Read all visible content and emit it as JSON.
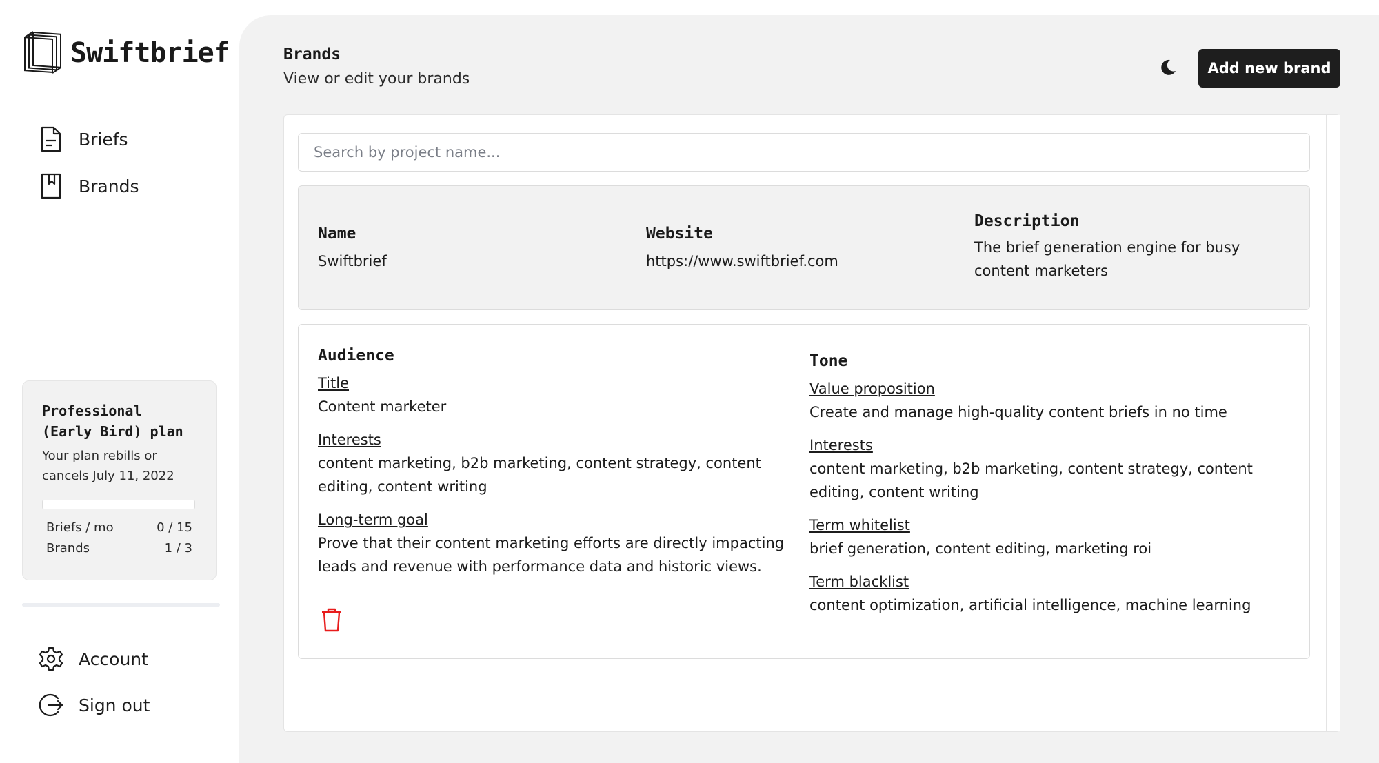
{
  "app": {
    "name": "Swiftbrief",
    "logo_icon": "stacked-squares-logo-icon"
  },
  "sidebar": {
    "nav": [
      {
        "label": "Briefs",
        "icon": "document-icon"
      },
      {
        "label": "Brands",
        "icon": "bookmark-icon"
      }
    ],
    "plan": {
      "title": "Professional (Early Bird) plan",
      "subtitle": "Your plan rebills or cancels July 11, 2022",
      "usage_progress": 0,
      "rows": [
        {
          "label": "Briefs / mo",
          "value": "0 / 15"
        },
        {
          "label": "Brands",
          "value": "1 / 3"
        }
      ]
    },
    "bottom_nav": [
      {
        "label": "Account",
        "icon": "gear-icon"
      },
      {
        "label": "Sign out",
        "icon": "sign-out-icon"
      }
    ]
  },
  "header": {
    "title": "Brands",
    "subtitle": "View or edit your brands",
    "theme_toggle_icon": "moon-icon",
    "add_button_label": "Add new brand"
  },
  "search": {
    "placeholder": "Search by project name...",
    "value": ""
  },
  "brand": {
    "name_header": "Name",
    "name": "Swiftbrief",
    "website_header": "Website",
    "website": "https://www.swiftbrief.com",
    "description_header": "Description",
    "description": "The brief generation engine for busy content marketers"
  },
  "audience": {
    "heading": "Audience",
    "title_label": "Title",
    "title_value": "Content marketer",
    "interests_label": "Interests",
    "interests_value": "content marketing, b2b marketing, content strategy, content editing, content writing",
    "goal_label": "Long-term goal",
    "goal_value": "Prove that their content marketing efforts are directly impacting leads and revenue with performance data and historic views."
  },
  "tone": {
    "heading": "Tone",
    "value_prop_label": "Value proposition",
    "value_prop_value": "Create and manage high-quality content briefs in no time",
    "interests_label": "Interests",
    "interests_value": "content marketing, b2b marketing, content strategy, content editing, content writing",
    "whitelist_label": "Term whitelist",
    "whitelist_value": "brief generation, content editing, marketing roi",
    "blacklist_label": "Term blacklist",
    "blacklist_value": "content optimization, artificial intelligence, machine learning"
  },
  "colors": {
    "accent_dark": "#1e1e1e",
    "panel_bg": "#f2f2f2",
    "delete_red": "#e81c1c"
  },
  "delete_icon": "trash-icon"
}
